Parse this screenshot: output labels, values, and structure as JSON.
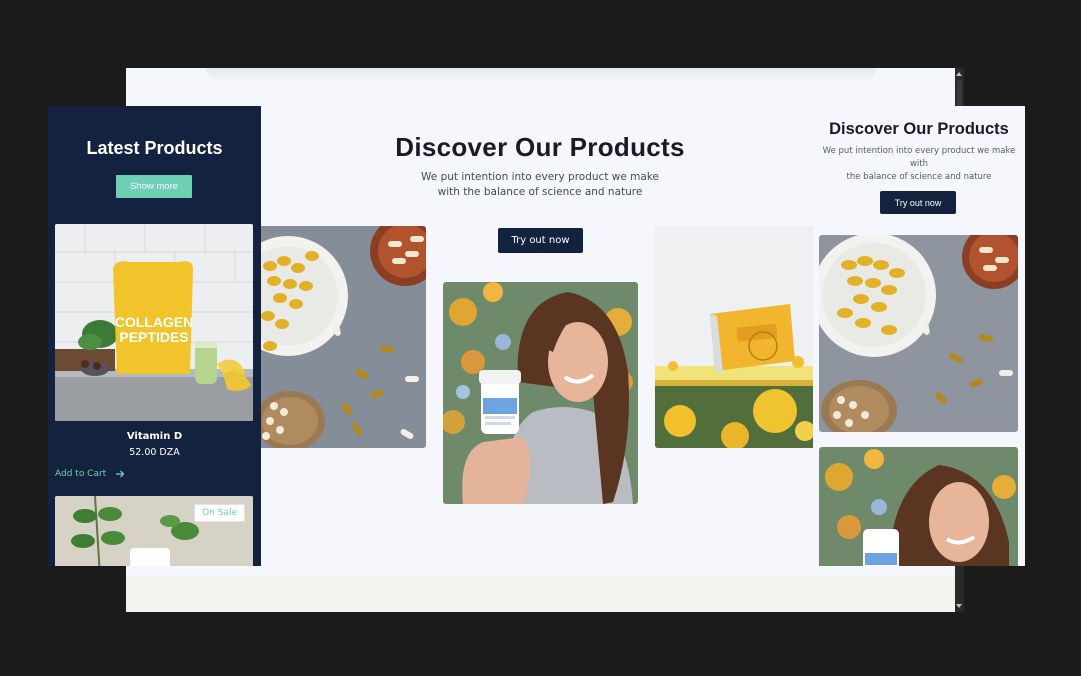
{
  "main": {
    "title": "Discover Our Products",
    "subtitle_line1": "We put intention into every product we make",
    "subtitle_line2": "with the balance of science and nature",
    "cta_label": "Try out now",
    "images": [
      "capsules-plate-photo",
      "woman-holding-bottle-photo",
      "vitamin-d3-box-photo"
    ]
  },
  "left_panel": {
    "title": "Latest Products",
    "show_more_label": "Show more",
    "product": {
      "package_text_line1": "COLLAGEN",
      "package_text_line2": "PEPTIDES",
      "name": "Vitamin D",
      "price": "52.00 DZA",
      "add_to_cart_label": "Add to Cart",
      "cart_icon": "arrow-right-icon"
    },
    "second_product": {
      "badge": "On Sale"
    }
  },
  "right_panel": {
    "title": "Discover Our Products",
    "subtitle_line1": "We put intention into every product we make with",
    "subtitle_line2": "the balance of science and nature",
    "cta_label": "Try out now"
  },
  "colors": {
    "navy": "#13223f",
    "accent_mint": "#6fcfb3",
    "page_background": "#f5f7fd",
    "outer_background": "#1b1b1b"
  }
}
